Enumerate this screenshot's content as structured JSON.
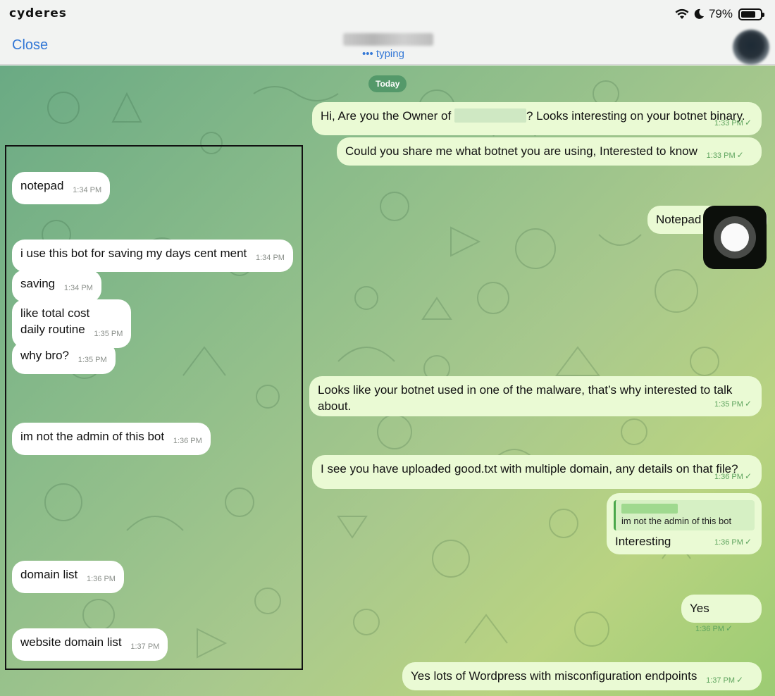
{
  "status_bar": {
    "brand": "cyderes",
    "battery": "79%",
    "battery_level": 0.79
  },
  "nav": {
    "close_label": "Close",
    "typing_label": "••• typing"
  },
  "chat": {
    "date_label": "Today",
    "incoming": [
      {
        "text": "notepad",
        "time": "1:34 PM"
      },
      {
        "text": "i use this bot for saving my days cent ment",
        "time": "1:34 PM"
      },
      {
        "text": "saving",
        "time": "1:34 PM"
      },
      {
        "line1": "like total cost",
        "line2": "daily routine",
        "time": "1:35 PM"
      },
      {
        "text": "why bro?",
        "time": "1:35 PM"
      },
      {
        "text": "im not the admin of this bot",
        "time": "1:36 PM"
      },
      {
        "text": "domain list",
        "time": "1:36 PM"
      },
      {
        "text": "website domain list",
        "time": "1:37 PM"
      }
    ],
    "outgoing": [
      {
        "text_before": "Hi, Are you the Owner of",
        "text_after": "? Looks interesting on your botnet binary.",
        "time": "1:33 PM"
      },
      {
        "text": "Could you share me what botnet you are using, Interested to know",
        "time": "1:33 PM"
      },
      {
        "text": "Notepad",
        "time": ""
      },
      {
        "text": "Looks like your botnet used in one of the malware, that’s why interested to talk about.",
        "time": "1:35 PM"
      },
      {
        "text": "I see you have uploaded good.txt with multiple domain, any details on that file?",
        "time": "1:36 PM"
      },
      {
        "quote": "im not the admin of this bot",
        "text": "Interesting",
        "time": "1:36 PM"
      },
      {
        "text": "Yes",
        "time": "1:36 PM"
      },
      {
        "text": "Yes lots of Wordpress with misconfiguration endpoints",
        "time": "1:37 PM"
      }
    ]
  }
}
